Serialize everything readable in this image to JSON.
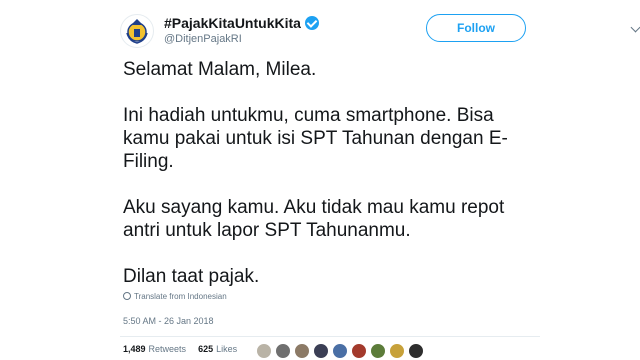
{
  "header": {
    "display_name": "#PajakKitaUntukKita",
    "handle": "@DitjenPajakRI",
    "follow_label": "Follow"
  },
  "tweet": {
    "text": "Selamat Malam, Milea.\n\nIni hadiah untukmu, cuma smartphone. Bisa kamu pakai untuk isi SPT Tahunan dengan E-Filing.\n\nAku sayang kamu. Aku tidak mau kamu repot antri untuk lapor SPT Tahunanmu.\n\nDilan taat pajak.",
    "translate_label": "Translate from Indonesian",
    "timestamp": "5:50 AM - 26 Jan 2018"
  },
  "stats": {
    "retweets_count": "1,489",
    "retweets_label": "Retweets",
    "likes_count": "625",
    "likes_label": "Likes"
  },
  "colors": {
    "accent": "#1da1f2",
    "text": "#14171a",
    "muted": "#657786"
  },
  "likers": [
    {
      "color": "#b9b3a6"
    },
    {
      "color": "#6f6f6f"
    },
    {
      "color": "#8c7a66"
    },
    {
      "color": "#3b3f55"
    },
    {
      "color": "#4a6fa5"
    },
    {
      "color": "#a33a2c"
    },
    {
      "color": "#5c7c3a"
    },
    {
      "color": "#c7a13a"
    },
    {
      "color": "#2e2e2e"
    }
  ]
}
